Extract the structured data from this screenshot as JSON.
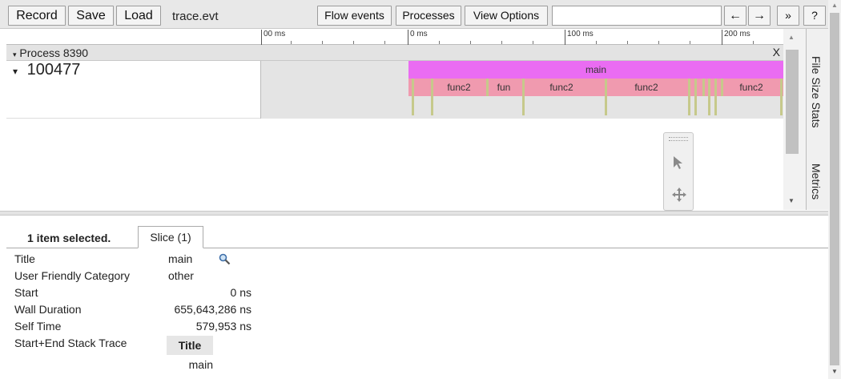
{
  "toolbar": {
    "record_label": "Record",
    "save_label": "Save",
    "load_label": "Load",
    "filename": "trace.evt",
    "flow_events_label": "Flow events",
    "processes_label": "Processes",
    "view_options_label": "View Options",
    "search_value": "",
    "prev_label": "←",
    "next_label": "→",
    "more_label": "»",
    "help_label": "?"
  },
  "ruler": {
    "ticks": [
      "00 ms",
      "0 ms",
      "100 ms",
      "200 ms"
    ]
  },
  "process": {
    "label": "Process 8390",
    "close_label": "X"
  },
  "thread": {
    "label": "100477",
    "slices": [
      {
        "name": "main",
        "color": "#ea6cf2"
      },
      {
        "name": "func2",
        "color": "#f09aaf"
      },
      {
        "name": "fun",
        "color": "#f09aaf"
      },
      {
        "name": "func2",
        "color": "#f09aaf"
      },
      {
        "name": "func2",
        "color": "#f09aaf"
      },
      {
        "name": "func2",
        "color": "#f09aaf"
      }
    ]
  },
  "side_tabs": {
    "file_size_stats": "File Size Stats",
    "metrics": "Metrics"
  },
  "details": {
    "selected_label": "1 item selected.",
    "slice_tab_label": "Slice (1)",
    "rows": [
      {
        "key": "Title",
        "value": "main"
      },
      {
        "key": "User Friendly Category",
        "value": "other"
      },
      {
        "key": "Start",
        "value": "0 ns"
      },
      {
        "key": "Wall Duration",
        "value": "655,643,286 ns"
      },
      {
        "key": "Self Time",
        "value": "579,953 ns"
      },
      {
        "key": "Start+End Stack Trace",
        "value": ""
      }
    ],
    "stack_header": "Title",
    "stack_value": "main"
  }
}
